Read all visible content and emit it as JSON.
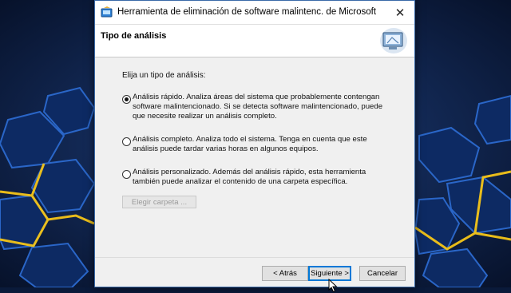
{
  "window": {
    "title": "Herramienta de eliminación de software malintenc. de Microsoft",
    "close_glyph": "✕",
    "icons": [
      "msrt-app-icon",
      "close-icon",
      "scan-computer-icon",
      "mouse-cursor-icon"
    ]
  },
  "header": {
    "section_title": "Tipo de análisis"
  },
  "scan": {
    "prompt": "Elija un tipo de análisis:",
    "options": [
      {
        "text": "Análisis rápido. Analiza áreas del sistema que probablemente contengan software malintencionado. Si se detecta software malintencionado, puede que necesite realizar un análisis completo.",
        "checked": true
      },
      {
        "text": "Análisis completo. Analiza todo el sistema. Tenga en cuenta que este análisis puede tardar varias horas en algunos equipos.",
        "checked": false
      },
      {
        "text": "Análisis personalizado. Además del análisis rápido, esta herramienta también puede analizar el contenido de una carpeta específica.",
        "checked": false
      }
    ],
    "browse_label": "Elegir carpeta ..."
  },
  "footer": {
    "back_label": "< Atrás",
    "next_label": "Siguiente >",
    "cancel_label": "Cancelar"
  },
  "colors": {
    "desktop_bg": "#0a1a3a",
    "glow": "#f5c518",
    "focus": "#0078d7"
  }
}
